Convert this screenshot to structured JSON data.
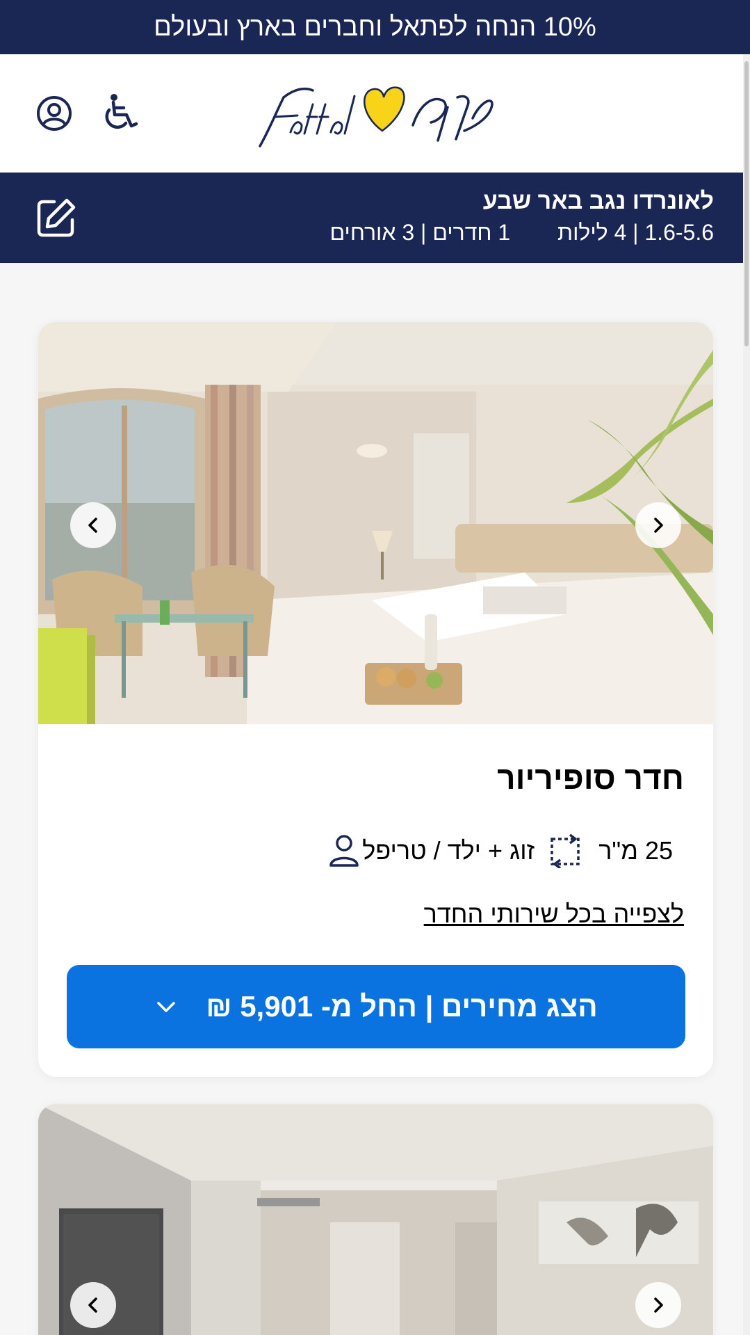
{
  "promo": {
    "text": "10% הנחה לפתאל וחברים בארץ ובעולם"
  },
  "header": {
    "logo_alt": "fattal פתאל",
    "profile_icon": "user-circle-icon",
    "accessibility_icon": "wheelchair-icon"
  },
  "search": {
    "hotel_name": "לאונרדו נגב באר שבע",
    "dates": "1.6-5.6",
    "nights": "4 לילות",
    "rooms": "1 חדרים",
    "guests": "3 אורחים",
    "edit_icon": "edit-icon"
  },
  "rooms": [
    {
      "name": "חדר סופיריור",
      "occupancy": "זוג + ילד / טריפל",
      "size": "25 מ\"ר",
      "amenities_link": "לצפייה בכל שירותי החדר",
      "price_button": "הצג מחירים | החל מ- 5,901 ₪"
    }
  ],
  "colors": {
    "navy": "#1a2654",
    "button_blue": "#0a73e0",
    "logo_yellow": "#f7d417"
  }
}
